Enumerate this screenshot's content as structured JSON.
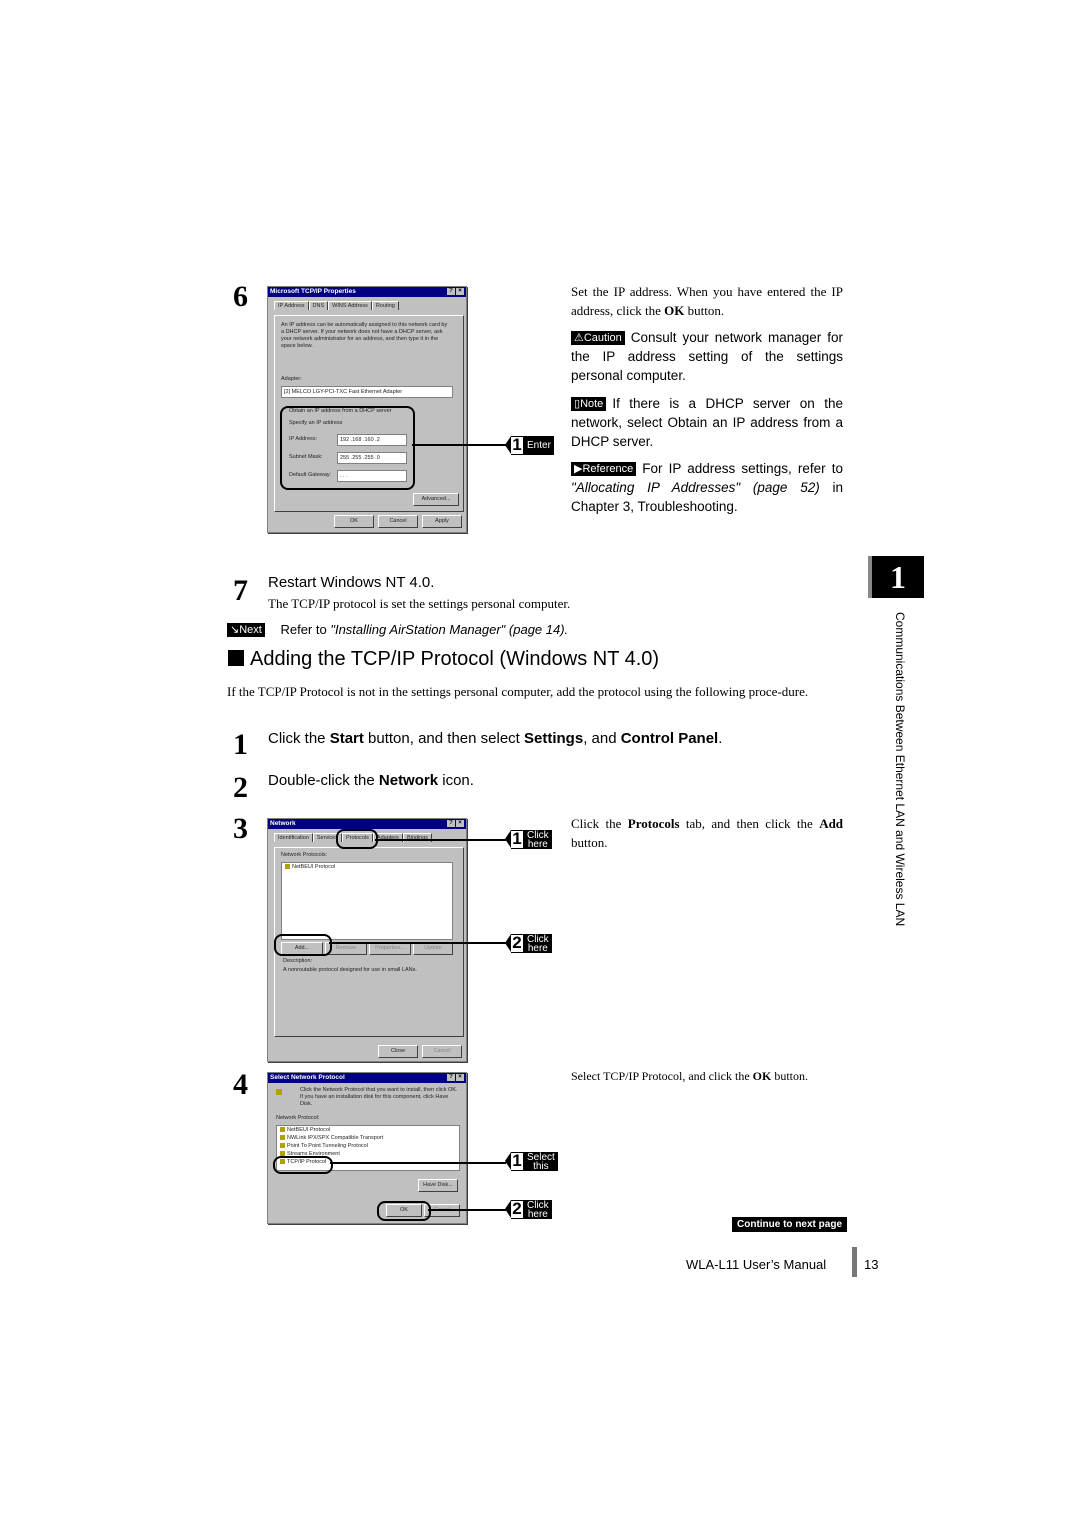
{
  "step6": {
    "number": "6",
    "dialog": {
      "title": "Microsoft TCP/IP Properties",
      "help_btn": "?",
      "close_btn": "×",
      "tabs": [
        "IP Address",
        "DNS",
        "WINS Address",
        "Routing"
      ],
      "description": "An IP address can be automatically assigned to this network card by a DHCP server. If your network does not have a DHCP server, ask your network administrator for an address, and then type it in the space below.",
      "adapter_label": "Adapter:",
      "adapter_value": "[2] MELCO LGY-PCI-TXC Fast Ethernet Adapter",
      "radio_obtain": "Obtain an IP address from a DHCP server",
      "radio_specify": "Specify an IP address",
      "ip_label": "IP Address:",
      "ip_value": "192 .168 .160 .2",
      "subnet_label": "Subnet Mask:",
      "subnet_value": "255 .255 .255 .0",
      "gateway_label": "Default Gateway:",
      "gateway_value": " .  .  .",
      "advanced_btn": "Advanced...",
      "ok_btn": "OK",
      "cancel_btn": "Cancel",
      "apply_btn": "Apply"
    },
    "callout1": {
      "num": "1",
      "label": "Enter"
    },
    "text1": "Set the IP address. When you have entered the IP address, click the",
    "text1_bold": "OK",
    "text1_end": "button.",
    "caution_badge": "⚠Caution",
    "caution_text": "Consult your network manager for the IP address setting of the settings personal computer.",
    "note_badge": "Note",
    "note_text": "If there is a DHCP server on the network, select Obtain an IP address from a DHCP server.",
    "reference_badge": "▶Reference",
    "reference_text_a": "For IP address settings, refer to",
    "reference_link": "\"Allocating IP Addresses\" (page 52)",
    "reference_text_b": "in Chapter 3, Troubleshooting."
  },
  "step7": {
    "number": "7",
    "title": "Restart Windows NT 4.0.",
    "subtext": "The TCP/IP protocol is set the settings personal computer."
  },
  "next": {
    "badge": "Next",
    "text": "Refer to",
    "link": "\"Installing AirStation Manager\" (page 14)."
  },
  "section": {
    "heading": "Adding the TCP/IP Protocol (Windows NT 4.0)",
    "intro": "If the TCP/IP Protocol is not in the settings personal computer, add the protocol using the following proce-dure."
  },
  "steps": [
    {
      "number": "1",
      "a": "Click the ",
      "b1": "Start",
      "c": " button, and then select ",
      "b2": "Settings",
      "d": ", and ",
      "b3": "Control Panel",
      "e": "."
    },
    {
      "number": "2",
      "a": "Double-click the ",
      "b1": "Network",
      "c": " icon."
    }
  ],
  "step3": {
    "number": "3",
    "dialog": {
      "title": "Network",
      "tabs": [
        "Identification",
        "Services",
        "Protocols",
        "Adapters",
        "Bindings"
      ],
      "list_label": "Network Protocols:",
      "items": [
        "NetBEUI Protocol"
      ],
      "buttons": [
        "Add...",
        "Remove",
        "Properties...",
        "Update"
      ],
      "description_label": "Description:",
      "description": "A nonroutable protocol designed for use in small LANs.",
      "close_btn": "Close",
      "cancel_btn": "Cancel"
    },
    "callout1": {
      "num": "1",
      "label1": "Click",
      "label2": "here"
    },
    "callout2": {
      "num": "2",
      "label1": "Click",
      "label2": "here"
    },
    "text_a": "Click the",
    "text_b1": "Protocols",
    "text_c": "tab, and then click the",
    "text_b2": "Add",
    "text_d": "button."
  },
  "step4": {
    "number": "4",
    "dialog": {
      "title": "Select Network Protocol",
      "instruction": "Click the Network Protocol that you want to install, then click OK. If you have an installation disk for this component, click Have Disk.",
      "list_label": "Network Protocol:",
      "items": [
        "NetBEUI Protocol",
        "NWLink IPX/SPX Compatible Transport",
        "Point To Point Tunneling Protocol",
        "Streams Environment",
        "TCP/IP Protocol"
      ],
      "have_disk_btn": "Have Disk...",
      "ok_btn": "OK",
      "cancel_btn": "Cancel"
    },
    "callout1": {
      "num": "1",
      "label1": "Select",
      "label2": "this"
    },
    "callout2": {
      "num": "2",
      "label1": "Click",
      "label2": "here"
    },
    "text_a": "Select TCP/IP Protocol, and click the",
    "text_b": "OK",
    "text_c": "button."
  },
  "sidebar": {
    "chapter_number": "1",
    "chapter_title": "Communications Between Ethernet LAN and Wireless LAN"
  },
  "continue_label": "Continue to next page",
  "footer": {
    "manual": "WLA-L11 User’s Manual",
    "page": "13"
  }
}
